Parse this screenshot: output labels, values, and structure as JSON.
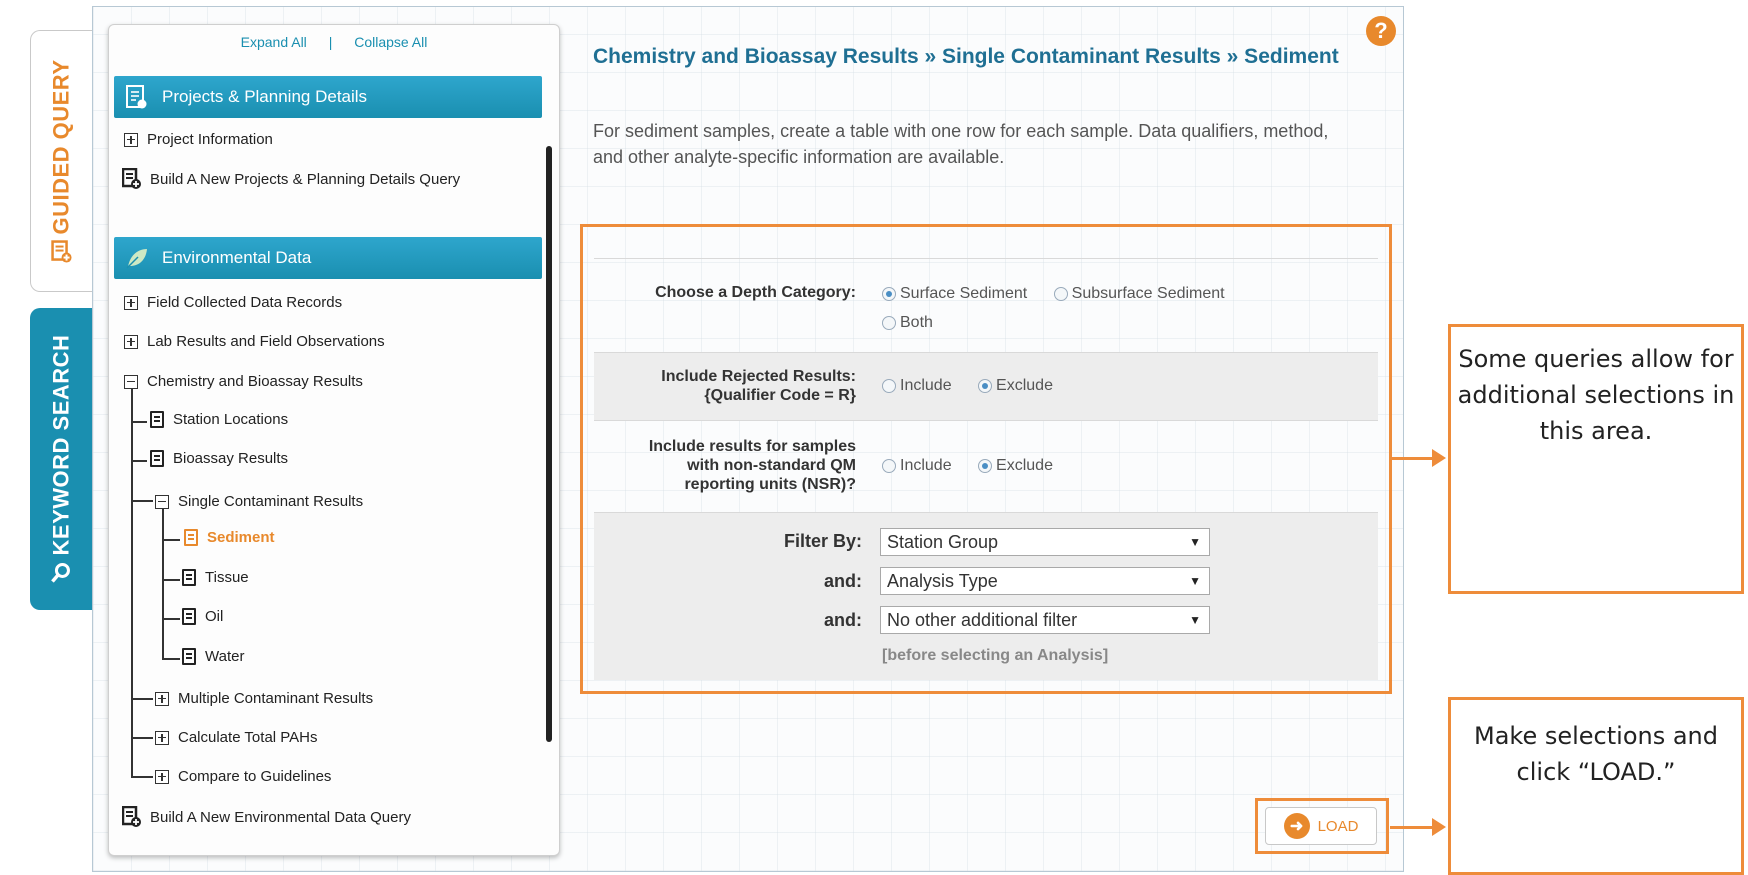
{
  "tabs": {
    "guided": "GUIDED QUERY",
    "keyword": "KEYWORD SEARCH"
  },
  "tree": {
    "expand_all": "Expand All",
    "separator": "|",
    "collapse_all": "Collapse All",
    "projects_header": "Projects & Planning Details",
    "project_information": "Project Information",
    "build_projects": "Build A New Projects & Planning Details Query",
    "env_header": "Environmental Data",
    "field_collected": "Field Collected Data Records",
    "lab_results": "Lab Results and Field Observations",
    "chem_bioassay": "Chemistry and Bioassay Results",
    "station_locations": "Station Locations",
    "bioassay_results": "Bioassay Results",
    "single_contaminant": "Single Contaminant Results",
    "sediment": "Sediment",
    "tissue": "Tissue",
    "oil": "Oil",
    "water": "Water",
    "multiple_contaminant": "Multiple Contaminant Results",
    "total_pahs": "Calculate Total PAHs",
    "compare_guidelines": "Compare to Guidelines",
    "build_env": "Build A New Environmental Data Query"
  },
  "content": {
    "title": "Chemistry and Bioassay Results » Single Contaminant Results » Sediment",
    "description": "For sediment samples, create a table with one row for each sample. Data qualifiers, method, and other analyte-specific information are available.",
    "help": "?"
  },
  "options": {
    "depth_label": "Choose a Depth Category:",
    "depth_surface": "Surface Sediment",
    "depth_subsurface": "Subsurface Sediment",
    "depth_both": "Both",
    "rejected_label_1": "Include Rejected Results:",
    "rejected_label_2": "{Qualifier Code = R}",
    "rejected_include": "Include",
    "rejected_exclude": "Exclude",
    "nsr_label_1": "Include results for samples",
    "nsr_label_2": "with non-standard QM",
    "nsr_label_3": "reporting units (NSR)?",
    "nsr_include": "Include",
    "nsr_exclude": "Exclude",
    "filter_by_label": "Filter By:",
    "filter_by_value": "Station Group",
    "and_label_1": "and:",
    "and_value_1": "Analysis Type",
    "and_label_2": "and:",
    "and_value_2": "No other additional filter",
    "hint": "[before selecting an Analysis]"
  },
  "load": {
    "label": "LOAD"
  },
  "callouts": {
    "callout_1": "Some queries allow for additional selections in this area.",
    "callout_2": "Make selections and click “LOAD.”"
  },
  "colors": {
    "accent_orange": "#ee8c3a",
    "header_blue": "#1a8fb0",
    "title_blue": "#1f6f93"
  }
}
